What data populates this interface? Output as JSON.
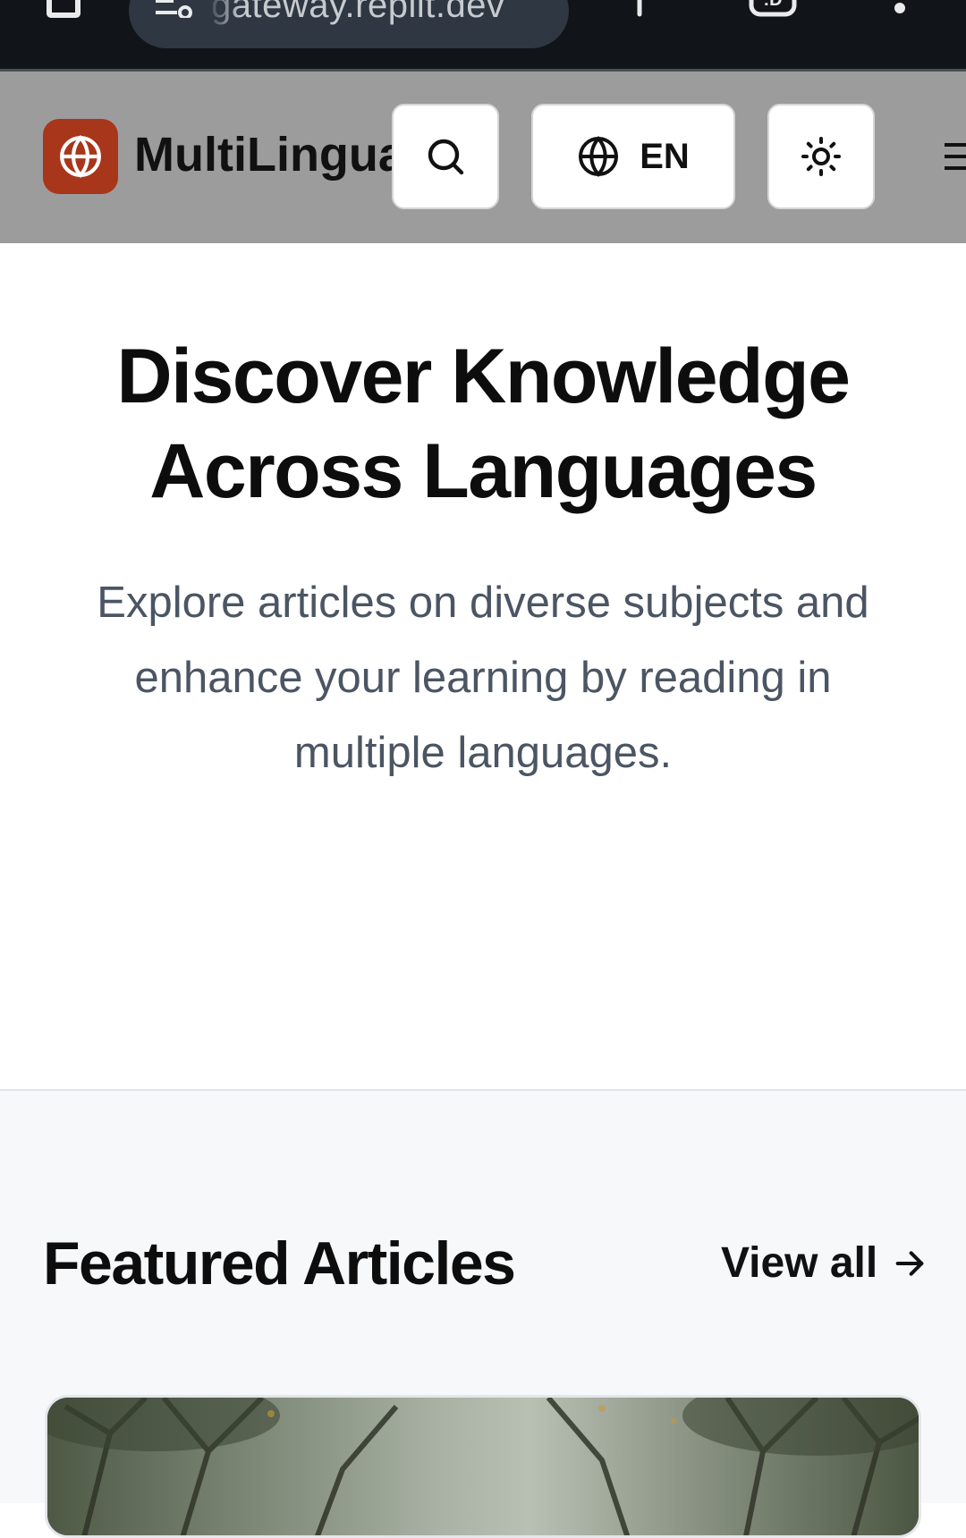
{
  "browser": {
    "url": "gateway.replit.dev"
  },
  "header": {
    "brand": "MultiLingua",
    "language_code": "EN"
  },
  "hero": {
    "title": "Discover Knowledge Across Languages",
    "subtitle": "Explore articles on diverse subjects and enhance your learning by reading in multiple languages."
  },
  "featured": {
    "title": "Featured Articles",
    "view_all": "View all"
  },
  "colors": {
    "brand_accent": "#a8361a",
    "header_bg": "#9c9c9c",
    "browser_bg": "#111418",
    "subtitle_text": "#4b5563"
  },
  "icons": {
    "logo": "globe-icon",
    "search": "search-icon",
    "language": "globe-icon",
    "theme": "sun-icon",
    "menu": "menu-icon",
    "view_all": "arrow-right-icon"
  }
}
